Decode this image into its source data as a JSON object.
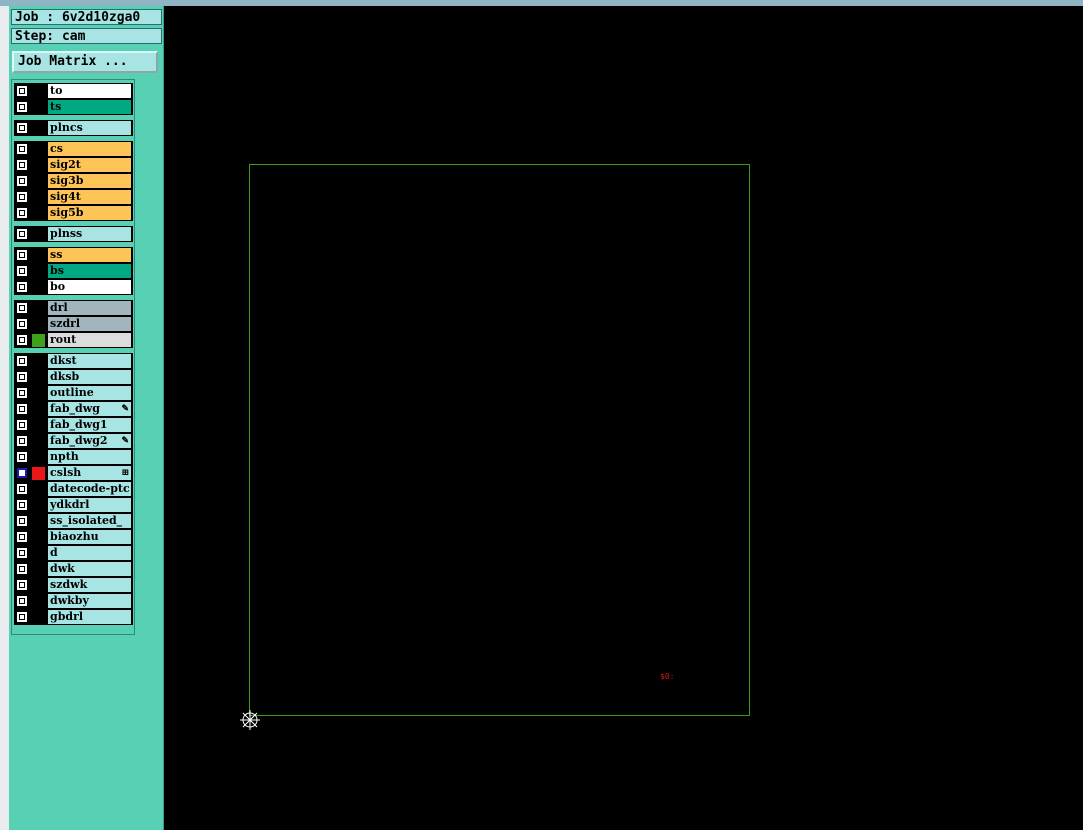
{
  "job_label": "Job : 6v2d10zga0",
  "step_label": "Step: cam",
  "job_matrix_button": "Job Matrix ...",
  "layer_groups": [
    {
      "layers": [
        {
          "name": "to",
          "color": "#ffffff"
        },
        {
          "name": "ts",
          "color": "#00a884"
        }
      ]
    },
    {
      "layers": [
        {
          "name": "plncs",
          "color": "#a8e4e4"
        }
      ]
    },
    {
      "layers": [
        {
          "name": "cs",
          "color": "#ffc458"
        },
        {
          "name": "sig2t",
          "color": "#ffc458"
        },
        {
          "name": "sig3b",
          "color": "#ffc458"
        },
        {
          "name": "sig4t",
          "color": "#ffc458"
        },
        {
          "name": "sig5b",
          "color": "#ffc458"
        }
      ]
    },
    {
      "layers": [
        {
          "name": "plnss",
          "color": "#a8e4e4"
        }
      ]
    },
    {
      "layers": [
        {
          "name": "ss",
          "color": "#ffc458"
        },
        {
          "name": "bs",
          "color": "#00a884"
        },
        {
          "name": "bo",
          "color": "#ffffff"
        }
      ]
    },
    {
      "layers": [
        {
          "name": "drl",
          "color": "#a2b4bc"
        },
        {
          "name": "szdrl",
          "color": "#a2b4bc"
        },
        {
          "name": "rout",
          "color": "#dcdcdc",
          "swatch": "#3fa01c"
        }
      ]
    },
    {
      "layers": [
        {
          "name": "dkst",
          "color": "#a8e4e4"
        },
        {
          "name": "dksb",
          "color": "#a8e4e4"
        },
        {
          "name": "outline",
          "color": "#a8e4e4"
        },
        {
          "name": "fab_dwg",
          "color": "#a8e4e4",
          "mark": "✎"
        },
        {
          "name": "fab_dwg1",
          "color": "#a8e4e4"
        },
        {
          "name": "fab_dwg2",
          "color": "#a8e4e4",
          "mark": "✎"
        },
        {
          "name": "npth",
          "color": "#a8e4e4"
        },
        {
          "name": "cslsh",
          "color": "#a8e4e4",
          "swatch": "#e81818",
          "active": true,
          "mark": "⊞"
        },
        {
          "name": "datecode-ptc",
          "color": "#a8e4e4"
        },
        {
          "name": "ydkdrl",
          "color": "#a8e4e4"
        },
        {
          "name": "ss_isolated_",
          "color": "#a8e4e4"
        },
        {
          "name": "biaozhu",
          "color": "#a8e4e4"
        },
        {
          "name": "d",
          "color": "#a8e4e4"
        },
        {
          "name": "dwk",
          "color": "#a8e4e4"
        },
        {
          "name": "szdwk",
          "color": "#a8e4e4"
        },
        {
          "name": "dwkby",
          "color": "#a8e4e4"
        },
        {
          "name": "gbdrl",
          "color": "#a8e4e4"
        }
      ]
    }
  ],
  "canvas": {
    "profile_color": "#3f9a1a",
    "red_label": "$0:"
  }
}
